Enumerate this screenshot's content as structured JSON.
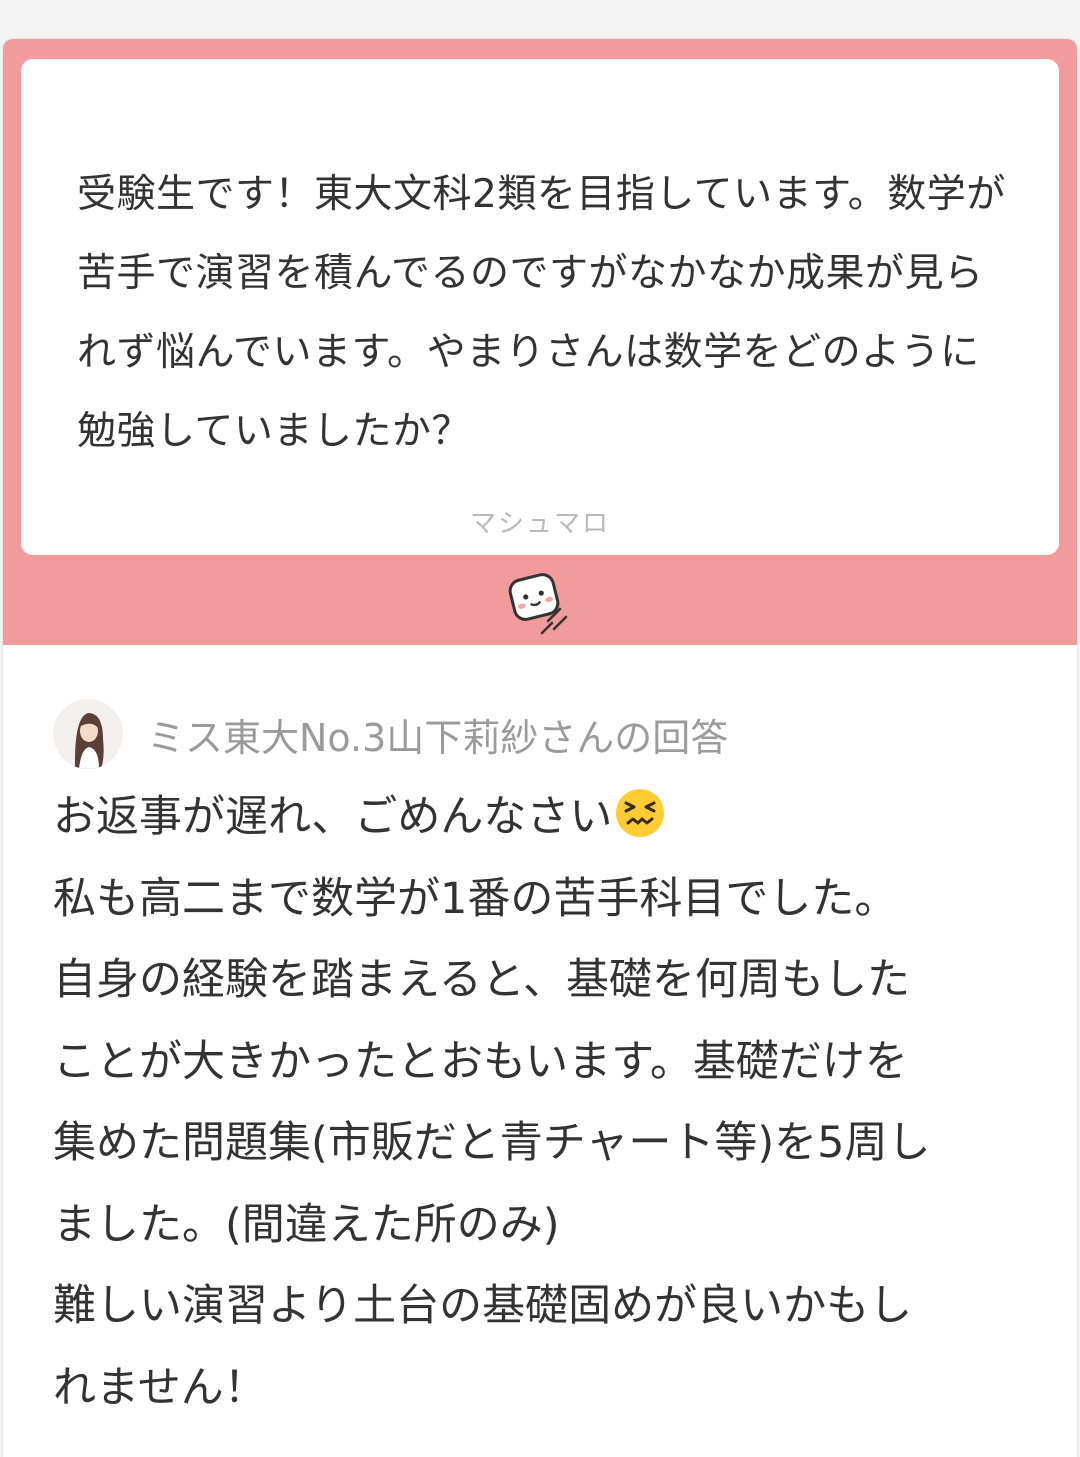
{
  "theme": {
    "accent": "#f19b9c",
    "emoji_color": "#ffcc33"
  },
  "question": {
    "text": "受験生です！東大文科2類を目指しています。数学が苦手で演習を積んでるのですがなかなか成果が見られず悩んでいます。やまりさんは数学をどのように勉強していましたか？",
    "brand": "マシュマロ"
  },
  "icons": {
    "marshmallow": "marshmallow-mascot-icon",
    "avatar": "avatar-photo",
    "emoji": "confounded-face-emoji"
  },
  "answer": {
    "header": "ミス東大No.3山下莉紗さんの回答",
    "lines": [
      "お返事が遅れ、ごめんなさい",
      "私も高二まで数学が1番の苦手科目でした。",
      "自身の経験を踏まえると、基礎を何周もした",
      "ことが大きかったとおもいます。基礎だけを",
      "集めた問題集(市販だと青チャート等)を5周し",
      "ました。(間違えた所のみ)",
      "難しい演習より土台の基礎固めが良いかもし",
      "れません！"
    ]
  }
}
